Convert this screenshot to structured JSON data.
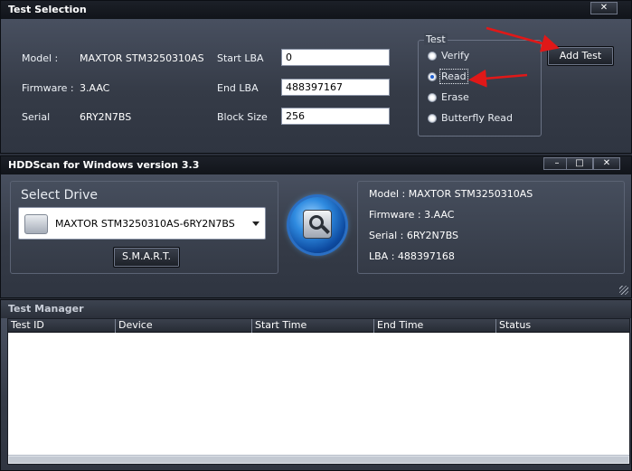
{
  "test_selection": {
    "title": "Test Selection",
    "close_icon": "close-icon",
    "labels": {
      "model": "Model :",
      "firmware": "Firmware :",
      "serial": "Serial",
      "start_lba": "Start LBA",
      "end_lba": "End LBA",
      "block_size": "Block Size"
    },
    "values": {
      "model": "MAXTOR STM3250310AS",
      "firmware": "3.AAC",
      "serial": "6RY2N7BS"
    },
    "inputs": {
      "start_lba": "0",
      "end_lba": "488397167",
      "block_size": "256"
    },
    "test_group": {
      "label": "Test",
      "options": [
        "Verify",
        "Read",
        "Erase",
        "Butterfly Read"
      ],
      "selected": "Read"
    },
    "add_test_label": "Add Test",
    "arrow_color": "#e01818"
  },
  "hddscan": {
    "title": "HDDScan for Windows version 3.3",
    "window_controls": [
      "minimize-icon",
      "maximize-icon",
      "close-icon"
    ],
    "select_drive_label": "Select Drive",
    "drive_selected": "MAXTOR STM3250310AS-6RY2N7BS",
    "smart_label": "S.M.A.R.T.",
    "info": {
      "model": "Model : MAXTOR STM3250310AS",
      "firmware": "Firmware : 3.AAC",
      "serial": "Serial : 6RY2N7BS",
      "lba": "LBA : 488397168"
    }
  },
  "test_manager": {
    "title": "Test Manager",
    "columns": [
      "Test ID",
      "Device",
      "Start Time",
      "End Time",
      "Status"
    ]
  }
}
